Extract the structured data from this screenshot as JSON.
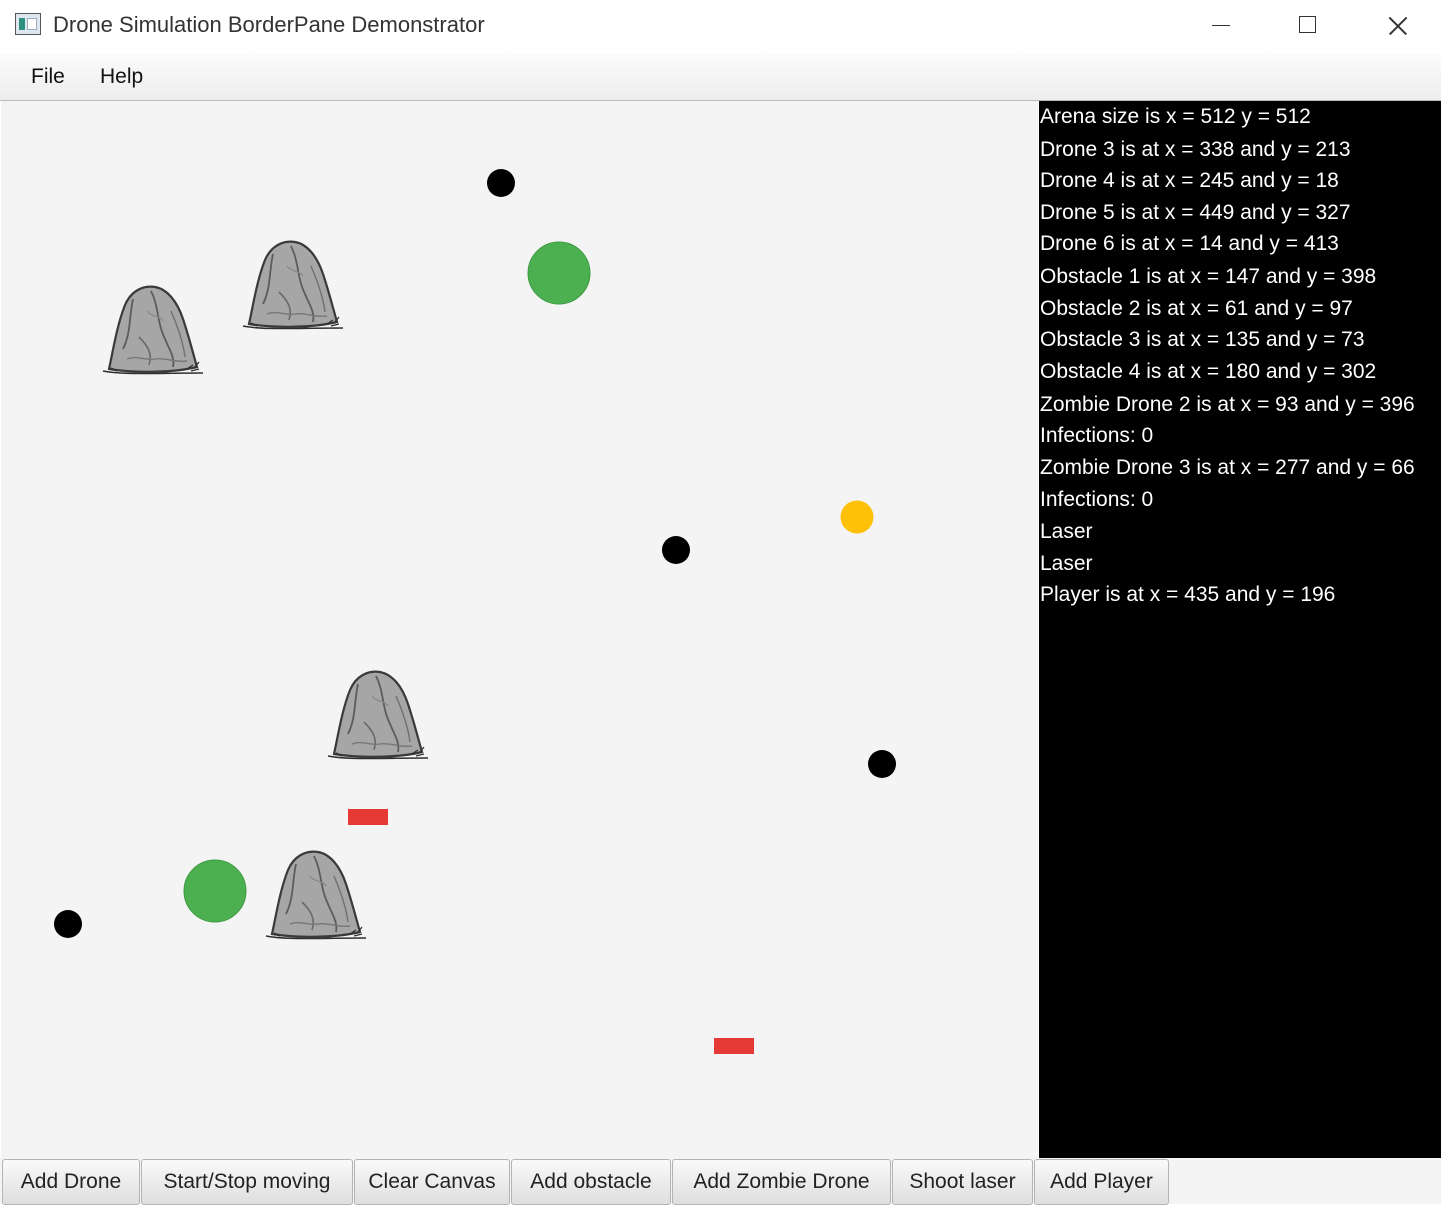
{
  "window": {
    "title": "Drone Simulation BorderPane Demonstrator",
    "app_icon": "java-app-icon",
    "controls": [
      "minimize-icon",
      "maximize-icon",
      "close-icon"
    ]
  },
  "menu": {
    "file": "File",
    "help": "Help"
  },
  "arena": {
    "background": "#f4f4f4",
    "colors": {
      "drone": "#000000",
      "zombie_drone": "#4caf50",
      "player": "#ffc107",
      "laser": "#e53935",
      "obstacle": "#9e9e9e"
    },
    "entities": [
      {
        "kind": "drone",
        "icon": "drone-icon"
      },
      {
        "kind": "drone",
        "icon": "drone-icon"
      },
      {
        "kind": "drone",
        "icon": "drone-icon"
      },
      {
        "kind": "drone",
        "icon": "drone-icon"
      },
      {
        "kind": "zombie-drone",
        "icon": "zombie-drone-icon"
      },
      {
        "kind": "zombie-drone",
        "icon": "zombie-drone-icon"
      },
      {
        "kind": "player",
        "icon": "player-icon"
      },
      {
        "kind": "laser",
        "icon": "laser-icon"
      },
      {
        "kind": "laser",
        "icon": "laser-icon"
      },
      {
        "kind": "obstacle",
        "icon": "rock-icon"
      },
      {
        "kind": "obstacle",
        "icon": "rock-icon"
      },
      {
        "kind": "obstacle",
        "icon": "rock-icon"
      },
      {
        "kind": "obstacle",
        "icon": "rock-icon"
      }
    ]
  },
  "info_panel": {
    "lines": [
      "Arena size is x = 512 y = 512",
      "Drone 3 is at x = 338 and y = 213",
      "Drone 4 is at x = 245 and y = 18",
      "Drone 5 is at x = 449 and y = 327",
      "Drone 6 is at x = 14 and y = 413",
      "Obstacle 1 is at x = 147 and y = 398",
      "Obstacle 2 is at x = 61 and y = 97",
      "Obstacle 3 is at x = 135 and y = 73",
      "Obstacle 4 is at x = 180 and y = 302",
      "Zombie Drone 2 is at x = 93 and y = 396",
      "Infections: 0",
      "Zombie Drone 3 is at x = 277 and y = 66",
      "Infections: 0",
      "Laser",
      "Laser",
      "Player is at x = 435 and y = 196"
    ]
  },
  "toolbar": {
    "add_drone": "Add Drone",
    "start_stop": "Start/Stop moving",
    "clear_canvas": "Clear Canvas",
    "add_obstacle": "Add obstacle",
    "add_zombie": "Add Zombie Drone",
    "shoot_laser": "Shoot laser",
    "add_player": "Add Player"
  }
}
